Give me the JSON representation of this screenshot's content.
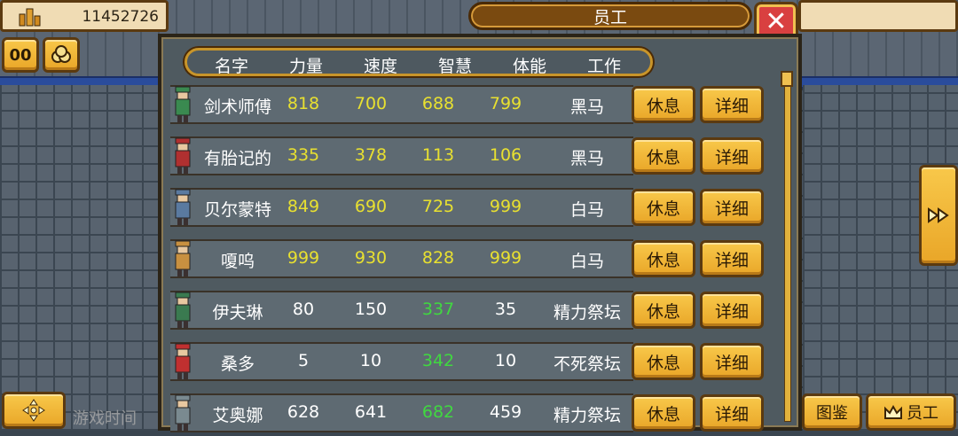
{
  "hud": {
    "money": "11452726",
    "pause_label": "00",
    "game_time_label": "游戏时间"
  },
  "dialog": {
    "title": "员工",
    "close_label": "✕"
  },
  "table": {
    "headers": [
      "名字",
      "力量",
      "速度",
      "智慧",
      "体能",
      "工作"
    ],
    "rows": [
      {
        "name": "剑术师傅",
        "str": "818",
        "spd": "700",
        "int": "688",
        "sta": "799",
        "job": "黑马",
        "color": "yellow",
        "avatar": "#3a8a50"
      },
      {
        "name": "有胎记的",
        "str": "335",
        "spd": "378",
        "int": "113",
        "sta": "106",
        "job": "黑马",
        "color": "yellow",
        "avatar": "#b03030"
      },
      {
        "name": "贝尔蒙特",
        "str": "849",
        "spd": "690",
        "int": "725",
        "sta": "999",
        "job": "白马",
        "color": "yellow",
        "avatar": "#5a7aa0"
      },
      {
        "name": "嗄呜",
        "str": "999",
        "spd": "930",
        "int": "828",
        "sta": "999",
        "job": "白马",
        "color": "yellow",
        "avatar": "#c89040"
      },
      {
        "name": "伊夫琳",
        "str": "80",
        "spd": "150",
        "int": "337",
        "sta": "35",
        "job": "精力祭坛",
        "color": "green",
        "avatar": "#3a7a50"
      },
      {
        "name": "桑多",
        "str": "5",
        "spd": "10",
        "int": "342",
        "sta": "10",
        "job": "不死祭坛",
        "color": "green",
        "avatar": "#c03030"
      },
      {
        "name": "艾奥娜",
        "str": "628",
        "spd": "641",
        "int": "682",
        "sta": "459",
        "job": "精力祭坛",
        "color": "green",
        "avatar": "#7a8a90"
      }
    ],
    "rest_label": "休息",
    "detail_label": "详细"
  },
  "bottom": {
    "atlas_label": "图鉴",
    "staff_label": "员工"
  },
  "colors": {
    "gold": "#f0b83a",
    "yellow_stat": "#e8e030",
    "green_stat": "#40d840",
    "white_stat": "#ffffff"
  },
  "icons": [
    "buildings-icon",
    "pause-icon",
    "items-icon",
    "close-icon",
    "fast-forward-icon",
    "dpad-icon",
    "crown-icon"
  ]
}
